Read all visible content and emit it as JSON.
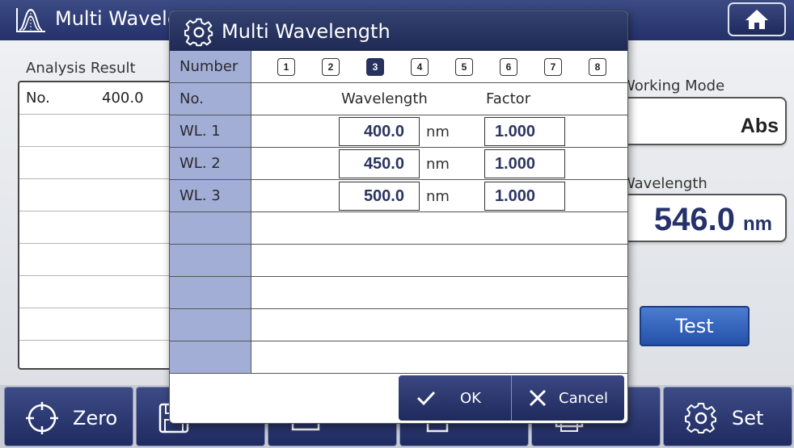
{
  "header": {
    "title": "Multi Wavele",
    "app_icon": "spectrum-icon",
    "home_icon": "home-icon"
  },
  "analysis": {
    "label": "Analysis Result",
    "header_no": "No.",
    "header_value": "400.0"
  },
  "side": {
    "working_mode_label": "Working Mode",
    "working_mode_value": "Abs",
    "wavelength_label": "Wavelength",
    "wavelength_value": "546.0",
    "wavelength_unit": "nm",
    "test_label": "Test"
  },
  "toolbar": {
    "zero_label": "Zero",
    "zero_icon": "crosshair-icon",
    "save_icon": "save-icon",
    "file_icon": "file-icon",
    "delete_icon": "delete-icon",
    "print_icon": "print-icon",
    "set_label": "Set",
    "set_icon": "gear-icon"
  },
  "dialog": {
    "title": "Multi Wavelength",
    "title_icon": "gear-icon",
    "number_label": "Number",
    "numbers": [
      "1",
      "2",
      "3",
      "4",
      "5",
      "6",
      "7",
      "8"
    ],
    "selected_number": "3",
    "col_no": "No.",
    "col_wavelength": "Wavelength",
    "col_factor": "Factor",
    "rows": [
      {
        "label": "WL. 1",
        "wavelength": "400.0",
        "unit": "nm",
        "factor": "1.000"
      },
      {
        "label": "WL. 2",
        "wavelength": "450.0",
        "unit": "nm",
        "factor": "1.000"
      },
      {
        "label": "WL. 3",
        "wavelength": "500.0",
        "unit": "nm",
        "factor": "1.000"
      }
    ],
    "ok_label": "OK",
    "cancel_label": "Cancel",
    "colors": {
      "header": "#24316a",
      "left_column": "#a3aed7",
      "value_text": "#2a3563"
    }
  }
}
